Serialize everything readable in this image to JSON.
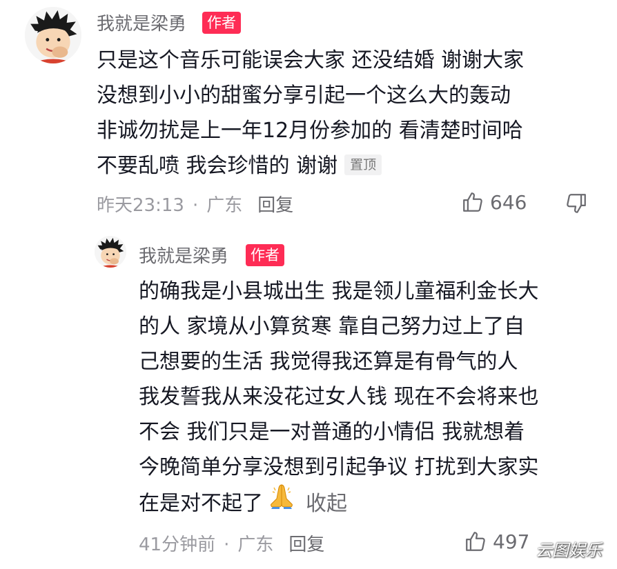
{
  "comment": {
    "username": "我就是梁勇",
    "author_badge": "作者",
    "lines": [
      "只是这个音乐可能误会大家 还没结婚 谢谢大家",
      "没想到小小的甜蜜分享引起一个这么大的轰动",
      "非诚勿扰是上一年12月份参加的 看清楚时间哈",
      "不要乱喷 我会珍惜的 谢谢"
    ],
    "pinned_label": "置顶",
    "time": "昨天23:13",
    "separator": "·",
    "location": "广东",
    "reply_label": "回复",
    "like_count": "646"
  },
  "reply": {
    "username": "我就是梁勇",
    "author_badge": "作者",
    "lines": [
      "的确我是小县城出生 我是领儿童福利金长大",
      "的人 家境从小算贫寒 靠自己努力过上了自",
      "己想要的生活 我觉得我还算是有骨气的人",
      "我发誓我从来没花过女人钱 现在不会将来也",
      "不会 我们只是一对普通的小情侣 我就想着",
      "今晚简单分享没想到引起争议 打扰到大家实",
      "在是对不起了"
    ],
    "collapse_label": "收起",
    "time": "41分钟前",
    "separator": "·",
    "location": "广东",
    "reply_label": "回复",
    "like_count": "497"
  },
  "watermark": "云图娱乐",
  "icons": {
    "avatar": "cartoon-avatar-icon",
    "like": "thumbs-up-icon",
    "dislike": "thumbs-down-icon",
    "emoji": "folded-hands-emoji-icon"
  },
  "colors": {
    "badge": "#fe2c55",
    "text": "#161823",
    "meta": "#9a9aa0"
  }
}
